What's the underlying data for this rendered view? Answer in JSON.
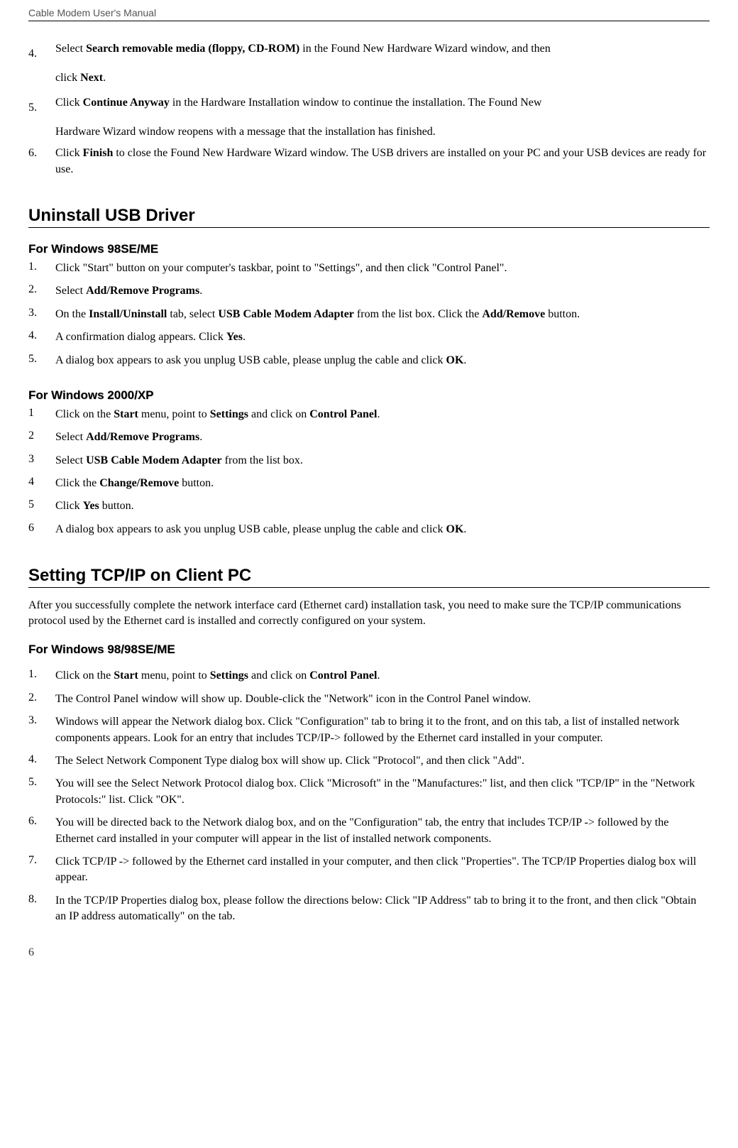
{
  "header": "Cable Modem User's Manual",
  "footer_page": "6",
  "top_steps": {
    "four_num": "4.",
    "four_a": "Select ",
    "four_b": "Search removable media (floppy, CD-ROM)",
    "four_c": " in the Found New Hardware Wizard window, and then",
    "four_d": "click ",
    "four_e": "Next",
    "four_f": ".",
    "five_num": "5.",
    "five_a": "Click ",
    "five_b": "Continue Anyway",
    "five_c": " in the Hardware Installation window to continue the installation. The Found New",
    "five_d": "Hardware Wizard window reopens with a message that the installation has finished.",
    "six_num": "6.",
    "six_a": "Click ",
    "six_b": "Finish",
    "six_c": " to close the Found New Hardware Wizard window. The USB drivers are installed on your PC and your USB devices are ready for use."
  },
  "section_uninstall_title": "Uninstall USB Driver",
  "sub_98se": "For Windows 98SE/ME",
  "win98_list": {
    "n1": "1.",
    "t1": "Click \"Start\" button on your computer's taskbar, point to \"Settings\", and then click \"Control Panel\".",
    "n2": "2.",
    "t2a": "Select ",
    "t2b": "Add/Remove Programs",
    "t2c": ".",
    "n3": "3.",
    "t3a": "On the ",
    "t3b": "Install/Uninstall",
    "t3c": " tab, select ",
    "t3d": "USB Cable Modem Adapter",
    "t3e": " from the list box. Click the ",
    "t3f": "Add/Remove",
    "t3g": " button.",
    "n4": "4.",
    "t4a": "A confirmation dialog appears. Click ",
    "t4b": "Yes",
    "t4c": ".",
    "n5": "5.",
    "t5a": "A dialog box appears to ask you unplug USB cable, please unplug the cable and click ",
    "t5b": "OK",
    "t5c": "."
  },
  "sub_2000": "For Windows 2000/XP",
  "win2000_list": {
    "n1": "1",
    "t1a": "Click on the ",
    "t1b": "Start",
    "t1c": " menu, point to ",
    "t1d": "Settings",
    "t1e": " and click on ",
    "t1f": "Control Panel",
    "t1g": ".",
    "n2": "2",
    "t2a": "Select ",
    "t2b": "Add/Remove Programs",
    "t2c": ".",
    "n3": "3",
    "t3a": "Select ",
    "t3b": "USB Cable Modem Adapter",
    "t3c": " from the list box.",
    "n4": "4",
    "t4a": "Click the ",
    "t4b": "Change/Remove",
    "t4c": " button.",
    "n5": "5",
    "t5a": "Click ",
    "t5b": "Yes",
    "t5c": " button.",
    "n6": "6",
    "t6a": "A dialog box appears to ask you unplug USB cable, please unplug the cable and click ",
    "t6b": "OK",
    "t6c": "."
  },
  "section_tcpip_title": "Setting TCP/IP on Client PC",
  "tcpip_para": "After you successfully complete the network interface card (Ethernet card) installation task, you need to make sure the TCP/IP communications protocol used by the Ethernet card is installed and correctly configured on your system.",
  "sub_9898se": "For Windows 98/98SE/ME",
  "win9898_list": {
    "n1": "1.",
    "t1a": "Click on the ",
    "t1b": "Start",
    "t1c": " menu, point to ",
    "t1d": "Settings",
    "t1e": " and click on ",
    "t1f": "Control Panel",
    "t1g": ".",
    "n2": "2.",
    "t2": "The Control Panel window will show up. Double-click the \"Network\" icon in the Control Panel window.",
    "n3": "3.",
    "t3": "Windows will appear the Network dialog box. Click \"Configuration\" tab to bring it to the front, and on this tab, a list of installed network components appears. Look for an entry that includes TCP/IP-> followed by the Ethernet card installed in your computer.",
    "n4": "4.",
    "t4": "The Select Network Component Type dialog box will show up. Click \"Protocol\", and then click \"Add\".",
    "n5": "5.",
    "t5": "You will see the Select Network Protocol dialog box. Click \"Microsoft\" in the \"Manufactures:\" list, and then click \"TCP/IP\" in the \"Network Protocols:\" list. Click \"OK\".",
    "n6": "6.",
    "t6": "You will be directed back to the Network dialog box, and on the \"Configuration\" tab, the entry that includes TCP/IP -> followed by the Ethernet card installed in your computer will appear in the list of installed network components.",
    "n7": "7.",
    "t7": "Click TCP/IP -> followed by the Ethernet card installed in your computer, and then click \"Properties\". The TCP/IP Properties dialog box will appear.",
    "n8": "8.",
    "t8": "In the TCP/IP Properties dialog box, please follow the directions below: Click \"IP Address\" tab to bring it to the front, and then click \"Obtain an IP address automatically\" on the tab."
  }
}
